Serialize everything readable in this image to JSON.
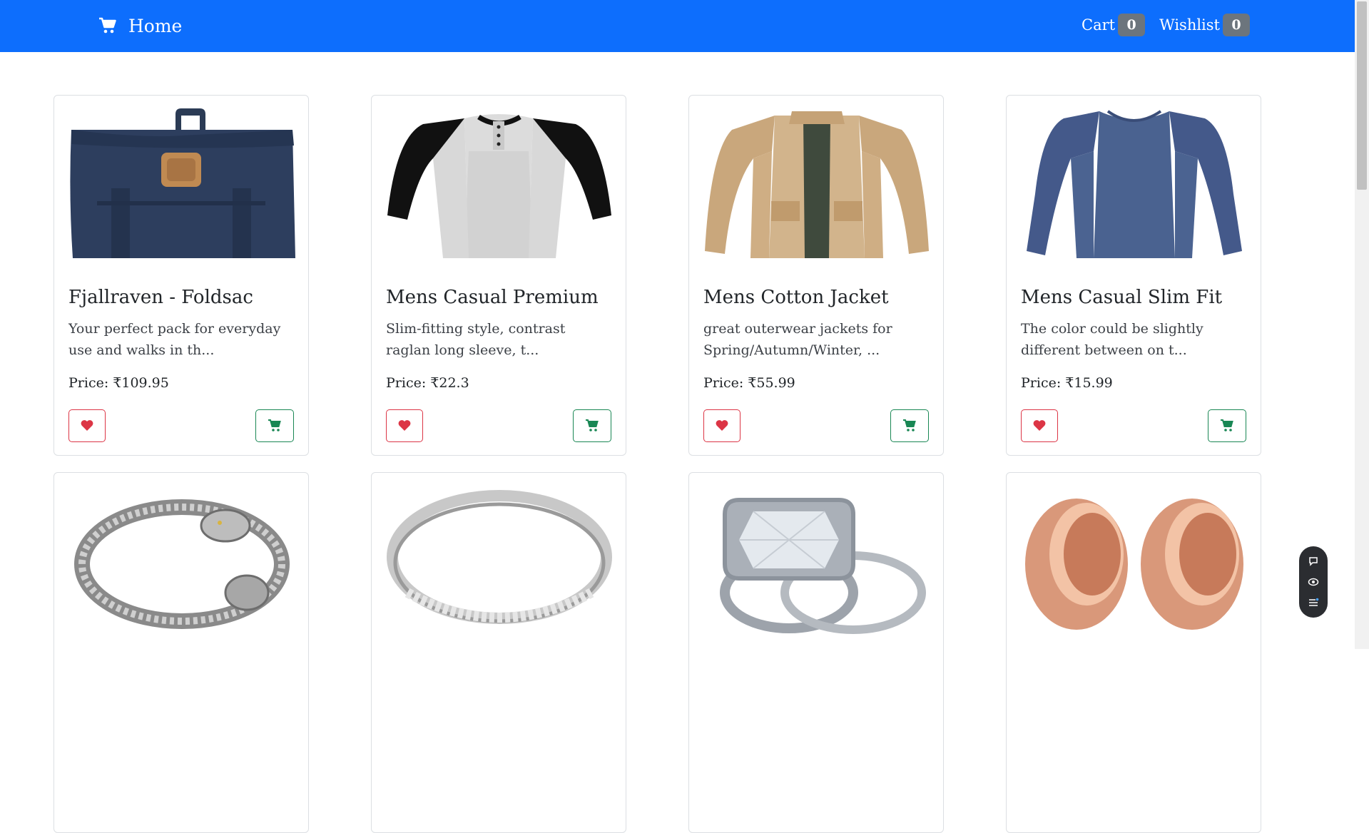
{
  "navbar": {
    "brand_icon": "shopping-cart-icon",
    "brand_label": "Home",
    "cart_label": "Cart",
    "cart_count": "0",
    "wishlist_label": "Wishlist",
    "wishlist_count": "0",
    "color": "#0d6efd"
  },
  "products": [
    {
      "title": "Fjallraven - Foldsac",
      "desc": "Your perfect pack for everyday use and walks in th...",
      "price": "Price: ₹109.95",
      "image": "backpack"
    },
    {
      "title": "Mens Casual Premium",
      "desc": "Slim-fitting style, contrast raglan long sleeve, t...",
      "price": "Price: ₹22.3",
      "image": "raglan-tshirt"
    },
    {
      "title": "Mens Cotton Jacket",
      "desc": "great outerwear jackets for Spring/Autumn/Winter, ...",
      "price": "Price: ₹55.99",
      "image": "cotton-jacket"
    },
    {
      "title": "Mens Casual Slim Fit",
      "desc": "The color could be slightly different between on t...",
      "price": "Price: ₹15.99",
      "image": "long-sleeve-tshirt"
    },
    {
      "title": "",
      "desc": "",
      "price": "",
      "image": "dragon-bracelet"
    },
    {
      "title": "",
      "desc": "",
      "price": "",
      "image": "silver-ring"
    },
    {
      "title": "",
      "desc": "",
      "price": "",
      "image": "diamond-ring-set"
    },
    {
      "title": "",
      "desc": "",
      "price": "",
      "image": "rose-gold-plugs"
    }
  ],
  "icons": {
    "wishlist_button": "heart-icon",
    "cart_button": "cart-icon",
    "float_tools": [
      "chat-icon",
      "eye-icon",
      "list-icon"
    ]
  },
  "colors": {
    "wish": "#dc3545",
    "cart": "#198754"
  }
}
